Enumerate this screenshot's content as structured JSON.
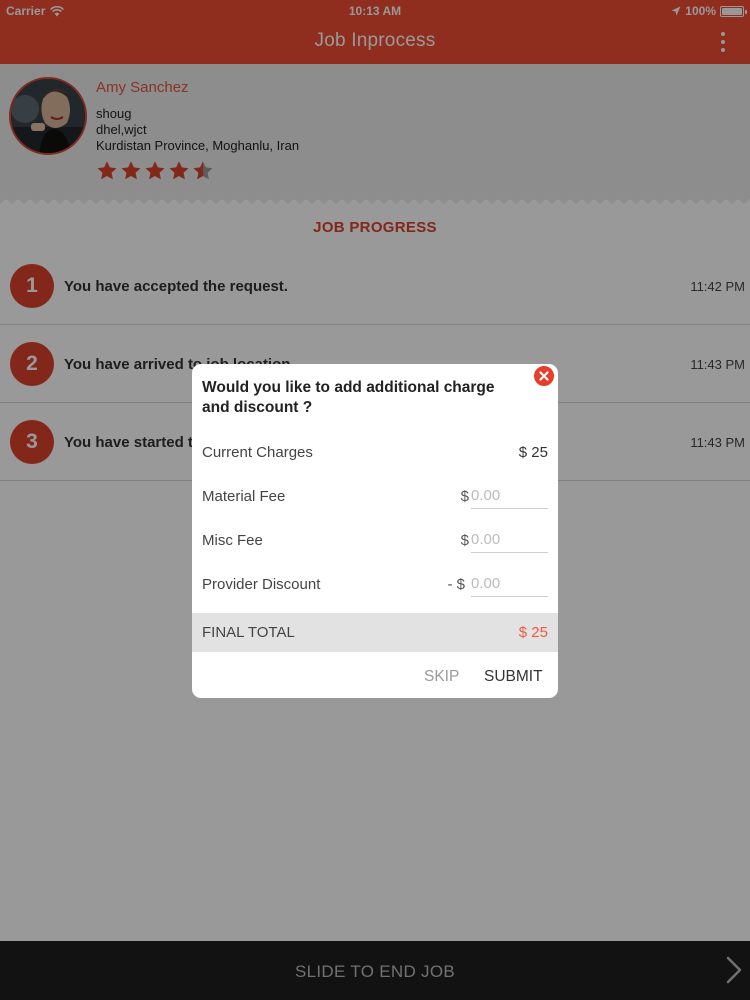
{
  "status_bar": {
    "carrier": "Carrier",
    "time": "10:13 AM",
    "battery": "100%"
  },
  "header": {
    "title": "Job Inprocess",
    "menu_icon": "more-vertical-icon",
    "background_color": "#ee4b33"
  },
  "profile": {
    "name": "Amy Sanchez",
    "line1": "shoug",
    "line2": "dhel,wjct",
    "line3": "Kurdistan Province,  Moghanlu,  Iran",
    "rating": 4.5,
    "rating_max": 5
  },
  "job_progress": {
    "title": "JOB PROGRESS",
    "steps": [
      {
        "number": "1",
        "text": "You have accepted the request.",
        "time": "11:42 PM"
      },
      {
        "number": "2",
        "text": "You have arrived to job location.",
        "time": "11:43 PM"
      },
      {
        "number": "3",
        "text": "You have started the job.",
        "time": "11:43 PM"
      }
    ]
  },
  "dialog": {
    "title": "Would you like to add additional charge and discount ?",
    "current_charges_label": "Current Charges",
    "current_charges_value": "$ 25",
    "material_fee_label": "Material Fee",
    "material_fee_prefix": "$",
    "material_fee_placeholder": "0.00",
    "misc_fee_label": "Misc Fee",
    "misc_fee_prefix": "$",
    "misc_fee_placeholder": "0.00",
    "discount_label": "Provider Discount",
    "discount_prefix": "- $",
    "discount_placeholder": "0.00",
    "final_total_label": "FINAL TOTAL",
    "final_total_value": "$ 25",
    "skip_label": "SKIP",
    "submit_label": "SUBMIT",
    "close_icon": "close-circle-icon",
    "accent_color": "#ee5a3e"
  },
  "slider": {
    "label": "SLIDE TO END JOB",
    "arrow_icon": "chevron-right-icon"
  }
}
